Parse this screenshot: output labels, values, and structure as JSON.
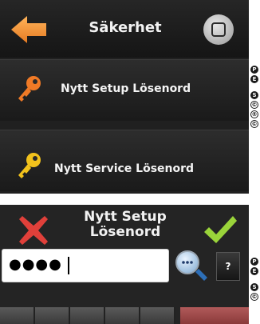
{
  "screen_security": {
    "title": "Säkerhet",
    "items": [
      {
        "label": "Nytt Setup Lösenord",
        "icon": "key-orange-icon"
      },
      {
        "label": "Nytt Service Lösenord",
        "icon": "key-yellow-icon"
      }
    ],
    "side_glyphs_top": [
      "P",
      "E"
    ],
    "side_glyphs_bottom": [
      "S",
      "©",
      "®",
      "©"
    ]
  },
  "screen_password": {
    "title_line1": "Nytt Setup",
    "title_line2": "Lösenord",
    "password_value": "●●●●",
    "help_label": "?",
    "side_glyphs_top": [
      "P",
      "E"
    ],
    "side_glyphs_bottom": [
      "S",
      "©"
    ]
  },
  "colors": {
    "arrow": "#f39a3b",
    "cancel": "#e0403a",
    "confirm": "#9ad43a",
    "panel_bg": "#202020"
  }
}
